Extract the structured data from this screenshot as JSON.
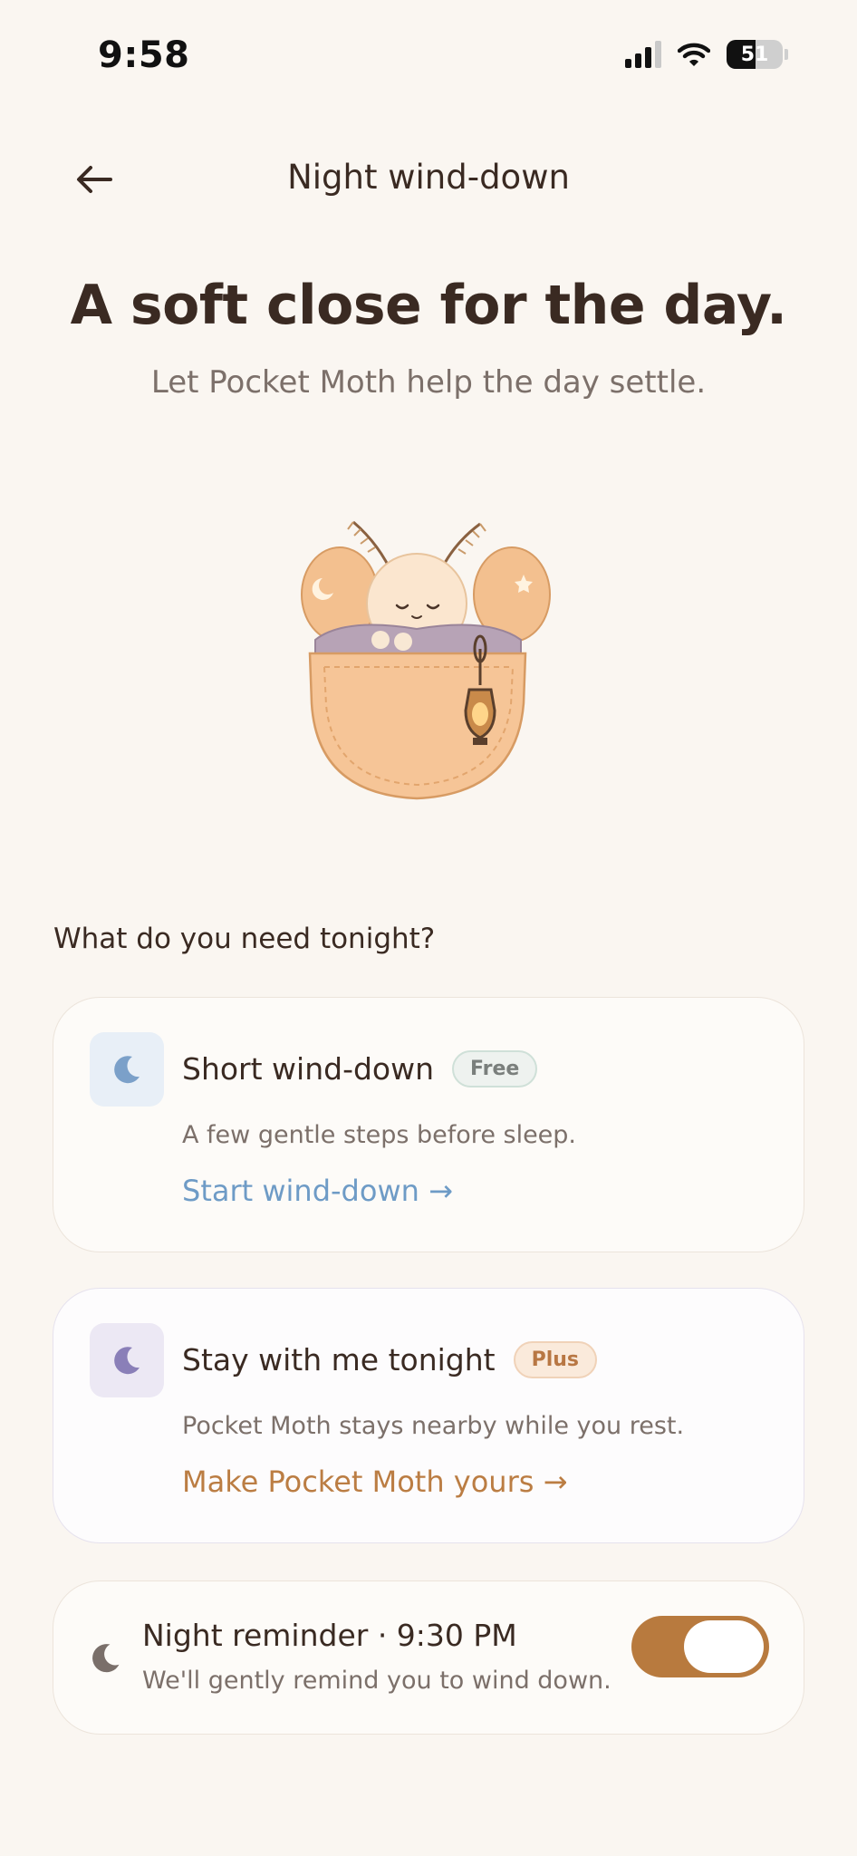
{
  "status_bar": {
    "time": "9:58",
    "battery": "51"
  },
  "header": {
    "title": "Night wind-down"
  },
  "hero": {
    "title": "A soft close for the day.",
    "subtitle": "Let Pocket Moth help the day settle."
  },
  "section_label": "What do you need tonight?",
  "options": [
    {
      "title": "Short wind-down",
      "badge": "Free",
      "description": "A few gentle steps before sleep.",
      "link": "Start wind-down →",
      "icon": "moon-icon",
      "accent": "#6e9bc6"
    },
    {
      "title": "Stay with me tonight",
      "badge": "Plus",
      "description": "Pocket Moth stays nearby while you rest.",
      "link": "Make Pocket Moth yours →",
      "icon": "moon-icon",
      "accent": "#bb7d43"
    }
  ],
  "reminder": {
    "title": "Night reminder · 9:30 PM",
    "subtitle": "We'll gently remind you to wind down.",
    "enabled": true,
    "toggle_color": "#b87a3e"
  }
}
